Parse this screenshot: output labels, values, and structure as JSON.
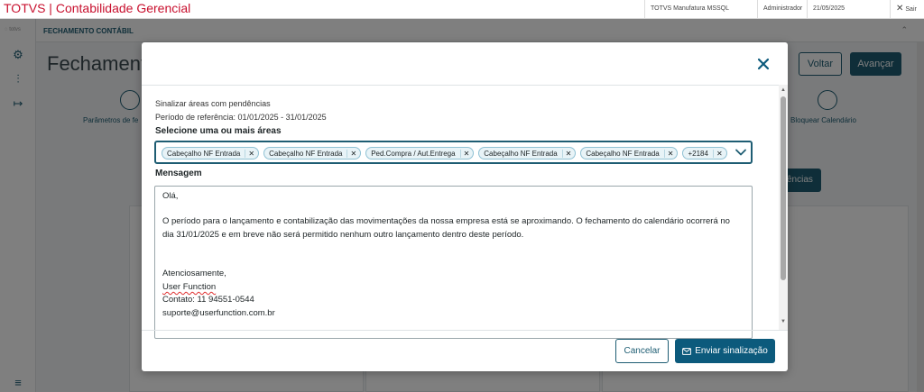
{
  "window": {
    "title": "TOTVS | Contabilidade Gerencial",
    "environment": "TOTVS Manufatura MSSQL",
    "user": "Administrador",
    "date": "21/05/2025",
    "exit_label": "Sair"
  },
  "background": {
    "breadcrumb": "FECHAMENTO CONTÁBIL",
    "page_title": "Fechamento",
    "back_label": "Voltar",
    "next_label": "Avançar",
    "step_1_label": "Parâmetros de fe",
    "step_last_label": "Bloquear Calendário",
    "pend_button_label": "ências"
  },
  "modal": {
    "info_line_1": "Sinalizar áreas com pendências",
    "info_line_2": "Período de referência: 01/01/2025 - 31/01/2025",
    "areas_label": "Selecione uma ou mais áreas",
    "chips": [
      "Cabeçalho NF Entrada",
      "Cabeçalho NF Entrada",
      "Ped.Compra / Aut.Entrega",
      "Cabeçalho NF Entrada",
      "Cabeçalho NF Entrada",
      "+2184"
    ],
    "message_label": "Mensagem",
    "message_lines": [
      "Olá,",
      "",
      "O período para o lançamento e contabilização das movimentações da nossa empresa está se aproximando. O fechamento do calendário ocorrerá no",
      "dia 31/01/2025 e em breve não será permitido nenhum outro lançamento dentro deste período.",
      "",
      "",
      "Atenciosamente,",
      "User Function",
      "Contato: 11 94551-0544",
      "suporte@userfunction.com.br"
    ],
    "cancel_label": "Cancelar",
    "send_label": "Enviar sinalização"
  },
  "colors": {
    "brand_red": "#c8102e",
    "primary": "#0c5a7c",
    "chip_bg": "#e8f3f7"
  }
}
